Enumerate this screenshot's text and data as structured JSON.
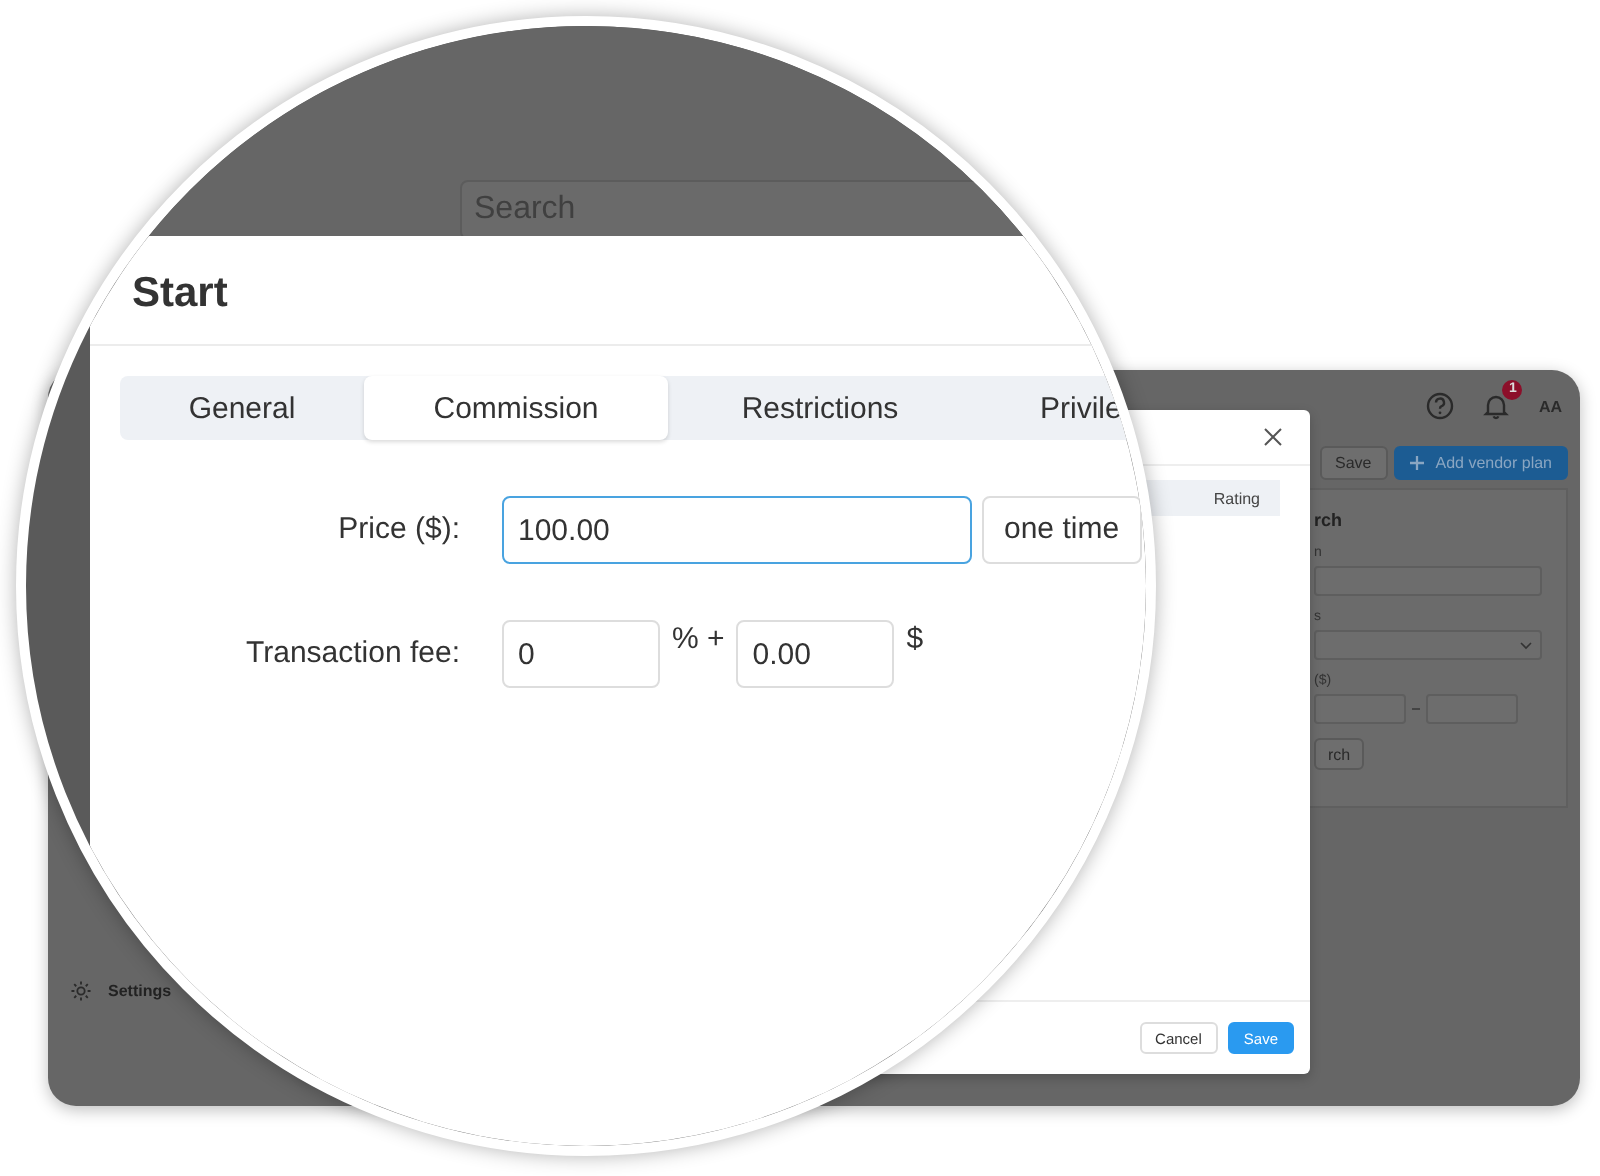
{
  "app": {
    "header": {
      "notification_count": "1",
      "avatar_initials": "AA"
    },
    "sidebar_items": [
      {
        "label": "Settings"
      }
    ],
    "toolbar_buttons": [
      {
        "label": "Save",
        "kind": "secondary"
      },
      {
        "label": "Add vendor plan",
        "kind": "primary"
      }
    ],
    "search_panel": {
      "title": "rch",
      "fields": [
        {
          "label": "n",
          "kind": "text"
        },
        {
          "label": "s",
          "kind": "select"
        },
        {
          "label": "($)",
          "kind": "range"
        }
      ],
      "button": "rch"
    }
  },
  "dialog": {
    "table_columns": [
      "Rating"
    ],
    "buttons": [
      {
        "label": "Cancel",
        "kind": "secondary"
      },
      {
        "label": "Save",
        "kind": "primary"
      }
    ]
  },
  "magnifier": {
    "search": {
      "placeholder": "Search"
    },
    "title": "Start",
    "tabs": [
      {
        "label": "General",
        "selected": false
      },
      {
        "label": "Commission",
        "selected": true
      },
      {
        "label": "Restrictions",
        "selected": false
      },
      {
        "label": "Privile",
        "selected": false
      }
    ],
    "price": {
      "label": "Price ($):",
      "value": "100.00",
      "focused": true,
      "period": "one time"
    },
    "fee": {
      "label": "Transaction fee:",
      "percent": "0",
      "separator": "% +",
      "fixed": "0.00",
      "currency": "$"
    }
  }
}
